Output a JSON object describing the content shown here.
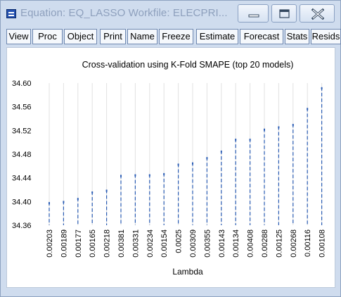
{
  "window": {
    "title": "Equation: EQ_LASSO   Workfile: ELECPRI..."
  },
  "toolbar": {
    "buttons": [
      "View",
      "Proc",
      "Object",
      "Print",
      "Name",
      "Freeze",
      "Estimate",
      "Forecast",
      "Stats",
      "Resids"
    ]
  },
  "chart_data": {
    "type": "scatter",
    "title": "Cross-validation using K-Fold SMAPE (top 20 models)",
    "xlabel": "Lambda",
    "ylabel": "",
    "categories": [
      "0.00203",
      "0.00189",
      "0.00177",
      "0.00165",
      "0.00218",
      "0.00381",
      "0.00331",
      "0.00234",
      "0.00154",
      "0.0025",
      "0.00309",
      "0.00355",
      "0.00143",
      "0.00134",
      "0.00408",
      "0.00288",
      "0.00125",
      "0.00268",
      "0.00116",
      "0.00108"
    ],
    "values": [
      34.399,
      34.401,
      34.406,
      34.417,
      34.42,
      34.445,
      34.446,
      34.446,
      34.448,
      34.464,
      34.466,
      34.475,
      34.486,
      34.506,
      34.506,
      34.523,
      34.527,
      34.531,
      34.558,
      34.593
    ],
    "ylim": [
      34.36,
      34.6
    ],
    "yticks": [
      "34.60",
      "34.56",
      "34.52",
      "34.48",
      "34.44",
      "34.40",
      "34.36"
    ],
    "style": "dropline",
    "grid": true,
    "color": "#2a5cb4"
  }
}
